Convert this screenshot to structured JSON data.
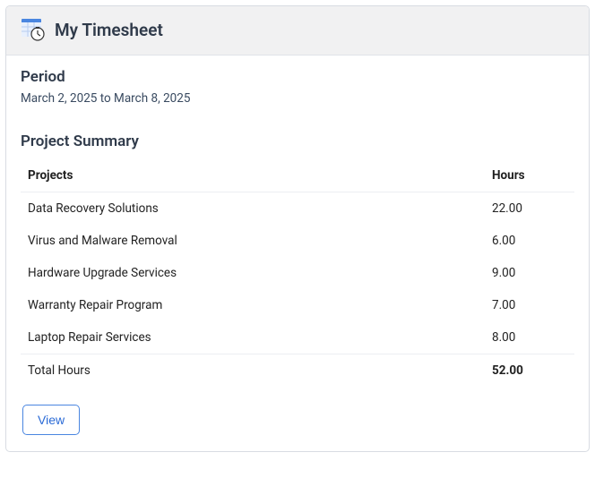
{
  "header": {
    "title": "My Timesheet"
  },
  "period": {
    "label": "Period",
    "range": "March 2, 2025 to March 8, 2025"
  },
  "summary": {
    "title": "Project Summary",
    "columns": {
      "projects": "Projects",
      "hours": "Hours"
    },
    "rows": [
      {
        "name": "Data Recovery Solutions",
        "hours": "22.00"
      },
      {
        "name": "Virus and Malware Removal",
        "hours": "6.00"
      },
      {
        "name": "Hardware Upgrade Services",
        "hours": "9.00"
      },
      {
        "name": "Warranty Repair Program",
        "hours": "7.00"
      },
      {
        "name": "Laptop Repair Services",
        "hours": "8.00"
      }
    ],
    "total": {
      "label": "Total Hours",
      "hours": "52.00"
    }
  },
  "actions": {
    "view": "View"
  }
}
